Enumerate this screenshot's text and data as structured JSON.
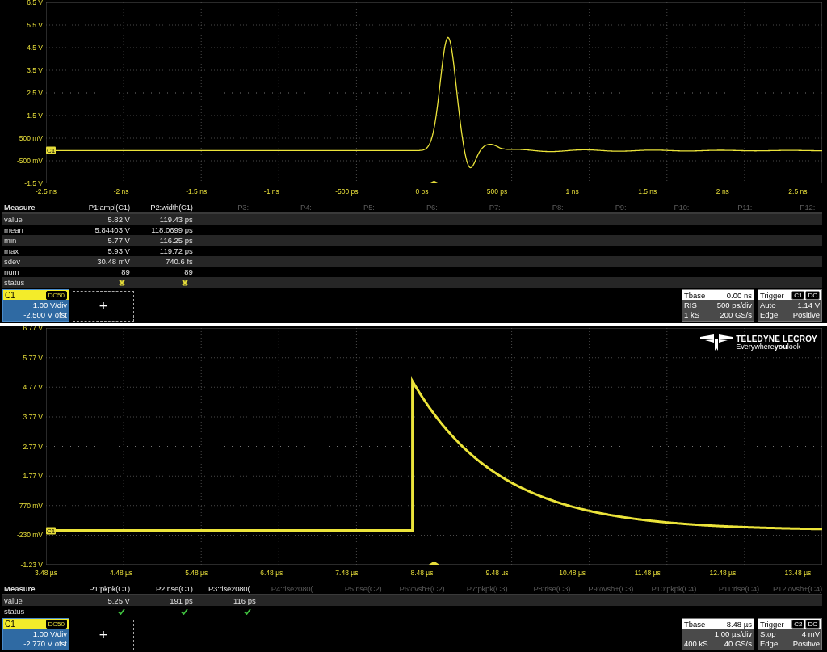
{
  "panels": [
    {
      "trace": {
        "kind": "pulse"
      },
      "ground_marker": "C1",
      "y_labels": [
        "6.5 V",
        "5.5 V",
        "4.5 V",
        "3.5 V",
        "2.5 V",
        "1.5 V",
        "500 mV",
        "-500 mV",
        "-1.5 V"
      ],
      "x_labels": [
        "-2.5 ns",
        "-2 ns",
        "-1.5 ns",
        "-1 ns",
        "-500 ps",
        "0 ps",
        "500 ps",
        "1 ns",
        "1.5 ns",
        "2 ns",
        "2.5 ns"
      ],
      "measure": {
        "title": "Measure",
        "columns": [
          {
            "label": "P1:ampl(C1)",
            "active": true
          },
          {
            "label": "P2:width(C1)",
            "active": true
          },
          {
            "label": "P3:---",
            "active": false
          },
          {
            "label": "P4:---",
            "active": false
          },
          {
            "label": "P5:---",
            "active": false
          },
          {
            "label": "P6:---",
            "active": false
          },
          {
            "label": "P7:---",
            "active": false
          },
          {
            "label": "P8:---",
            "active": false
          },
          {
            "label": "P9:---",
            "active": false
          },
          {
            "label": "P10:---",
            "active": false
          },
          {
            "label": "P11:---",
            "active": false
          },
          {
            "label": "P12:---",
            "active": false
          }
        ],
        "rows": [
          {
            "label": "value",
            "cells": [
              "5.82 V",
              "119.43 ps"
            ]
          },
          {
            "label": "mean",
            "cells": [
              "5.84403 V",
              "118.0699 ps"
            ]
          },
          {
            "label": "min",
            "cells": [
              "5.77 V",
              "116.25 ps"
            ]
          },
          {
            "label": "max",
            "cells": [
              "5.93 V",
              "119.72 ps"
            ]
          },
          {
            "label": "sdev",
            "cells": [
              "30.48 mV",
              "740.6 fs"
            ]
          },
          {
            "label": "num",
            "cells": [
              "89",
              "89"
            ]
          }
        ],
        "status": {
          "label": "status",
          "cells": [
            {
              "kind": "fail"
            },
            {
              "kind": "fail"
            }
          ]
        }
      },
      "channel": {
        "name": "C1",
        "coupling": "DC50",
        "scale": "1.00 V/div",
        "offset": "-2.500 V ofst"
      },
      "add_button": "+",
      "timebase": {
        "title": "Tbase",
        "delay": "0.00 ns",
        "mode": "RIS",
        "scale": "500 ps/div",
        "samples": "1 kS",
        "rate": "200 GS/s"
      },
      "trigger": {
        "title": "Trigger",
        "source": "C1",
        "coupling": "DC",
        "mode": "Auto",
        "threshold": "1.14 V",
        "type": "Edge",
        "slope": "Positive"
      }
    },
    {
      "trace": {
        "kind": "step_decay"
      },
      "ground_marker": "C1",
      "logo": {
        "name": "TELEDYNE LECROY",
        "tagline": "Everywhere**you**look"
      },
      "y_labels": [
        "6.77 V",
        "5.77 V",
        "4.77 V",
        "3.77 V",
        "2.77 V",
        "1.77 V",
        "770 mV",
        "-230 mV",
        "-1.23 V"
      ],
      "x_labels": [
        "3.48 µs",
        "4.48 µs",
        "5.48 µs",
        "6.48 µs",
        "7.48 µs",
        "8.48 µs",
        "9.48 µs",
        "10.48 µs",
        "11.48 µs",
        "12.48 µs",
        "13.48 µs"
      ],
      "measure": {
        "title": "Measure",
        "columns": [
          {
            "label": "P1:pkpk(C1)",
            "active": true
          },
          {
            "label": "P2:rise(C1)",
            "active": true
          },
          {
            "label": "P3:rise2080(...",
            "active": true
          },
          {
            "label": "P4:rise2080(...",
            "active": false
          },
          {
            "label": "P5:rise(C2)",
            "active": false
          },
          {
            "label": "P6:ovsh+(C2)",
            "active": false
          },
          {
            "label": "P7:pkpk(C3)",
            "active": false
          },
          {
            "label": "P8:rise(C3)",
            "active": false
          },
          {
            "label": "P9:ovsh+(C3)",
            "active": false
          },
          {
            "label": "P10:pkpk(C4)",
            "active": false
          },
          {
            "label": "P11:rise(C4)",
            "active": false
          },
          {
            "label": "P12:ovsh+(C4)",
            "active": false
          }
        ],
        "rows": [
          {
            "label": "value",
            "cells": [
              "5.25 V",
              "191 ps",
              "116 ps"
            ]
          }
        ],
        "status": {
          "label": "status",
          "cells": [
            {
              "kind": "pass"
            },
            {
              "kind": "pass"
            },
            {
              "kind": "pass"
            }
          ]
        }
      },
      "channel": {
        "name": "C1",
        "coupling": "DC50",
        "scale": "1.00 V/div",
        "offset": "-2.770 V ofst"
      },
      "add_button": "+",
      "timebase": {
        "title": "Tbase",
        "delay": "-8.48 µs",
        "scale": "1.00 µs/div",
        "samples": "400 kS",
        "rate": "40 GS/s"
      },
      "trigger": {
        "title": "Trigger",
        "source": "C2",
        "coupling": "DC",
        "mode": "Stop",
        "threshold": "4 mV",
        "type": "Edge",
        "slope": "Positive"
      }
    }
  ]
}
